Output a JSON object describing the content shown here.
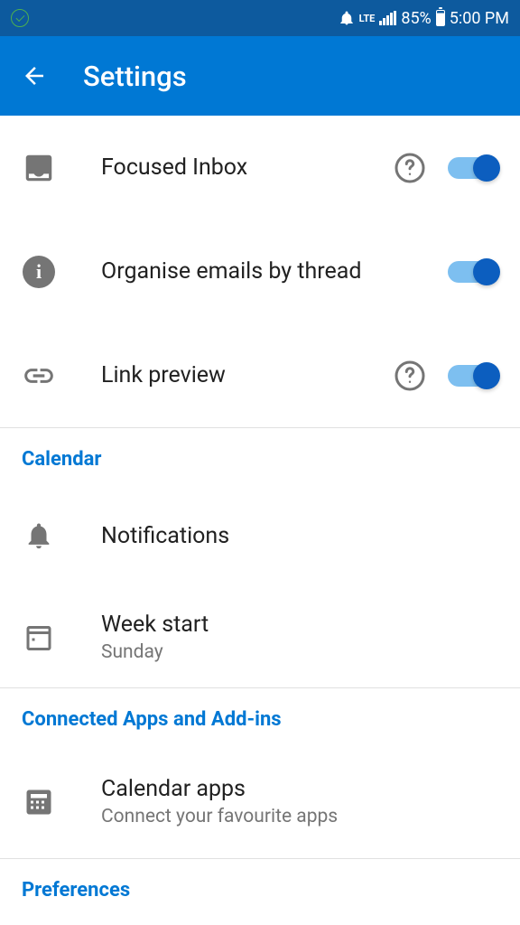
{
  "statusBar": {
    "lte": "LTE",
    "battery": "85%",
    "time": "5:00 PM"
  },
  "appBar": {
    "title": "Settings"
  },
  "settings": {
    "focusedInbox": {
      "label": "Focused Inbox"
    },
    "organiseThread": {
      "label": "Organise emails by thread"
    },
    "linkPreview": {
      "label": "Link preview"
    }
  },
  "sections": {
    "calendar": "Calendar",
    "connectedApps": "Connected Apps and Add-ins",
    "preferences": "Preferences"
  },
  "calendarSettings": {
    "notifications": {
      "label": "Notifications"
    },
    "weekStart": {
      "label": "Week start",
      "value": "Sunday"
    }
  },
  "connectedApps": {
    "calendarApps": {
      "label": "Calendar apps",
      "sub": "Connect your favourite apps"
    }
  }
}
